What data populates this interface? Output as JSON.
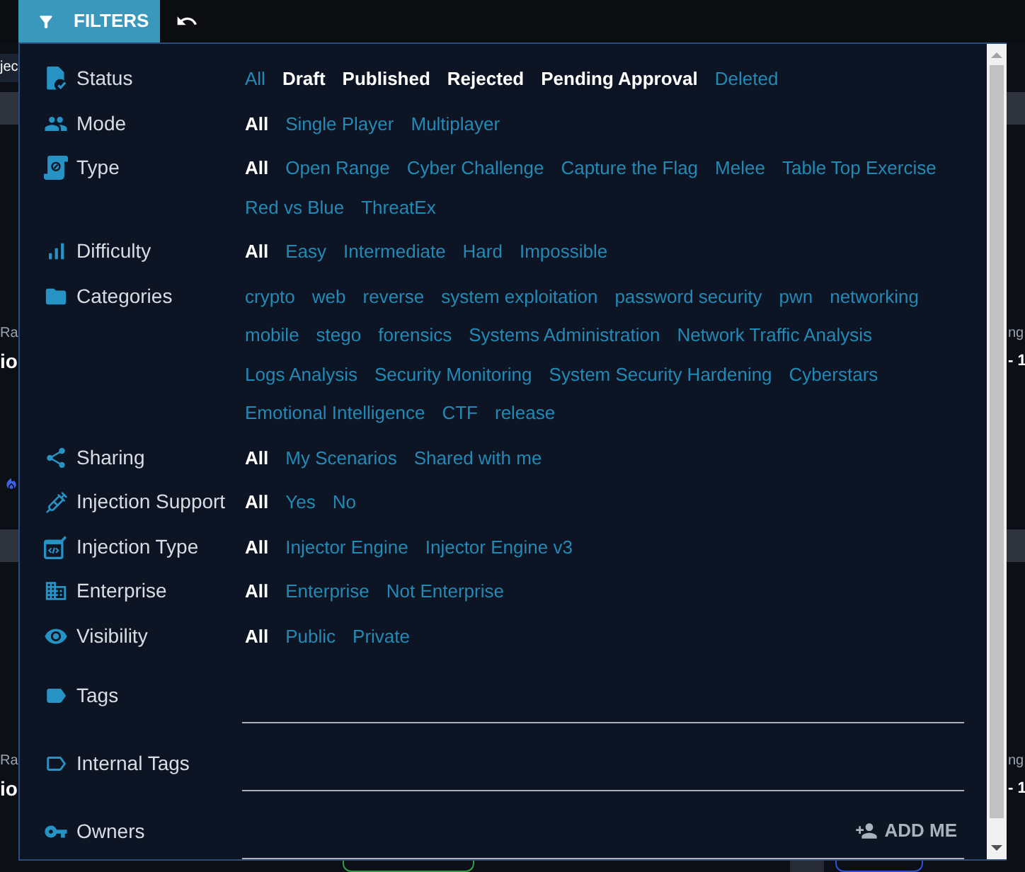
{
  "toolbar": {
    "filter_button": "FILTERS"
  },
  "background": {
    "tab": "jec",
    "left_cards": [
      {
        "subtitle": "Ra",
        "title": "io"
      },
      {
        "subtitle": "Ra",
        "title": "io"
      }
    ],
    "right_cards": [
      {
        "subtitle": "ng",
        "title": "- 1"
      },
      {
        "subtitle": "ng",
        "title": "- 1"
      }
    ]
  },
  "filters": [
    {
      "kind": "options",
      "label": "Status",
      "options": [
        {
          "label": "All",
          "selected": false
        },
        {
          "label": "Draft",
          "selected": true
        },
        {
          "label": "Published",
          "selected": true
        },
        {
          "label": "Rejected",
          "selected": true
        },
        {
          "label": "Pending Approval",
          "selected": true
        },
        {
          "label": "Deleted",
          "selected": false
        }
      ]
    },
    {
      "kind": "options",
      "label": "Mode",
      "options": [
        {
          "label": "All",
          "selected": true
        },
        {
          "label": "Single Player",
          "selected": false
        },
        {
          "label": "Multiplayer",
          "selected": false
        }
      ]
    },
    {
      "kind": "options",
      "label": "Type",
      "options": [
        {
          "label": "All",
          "selected": true
        },
        {
          "label": "Open Range",
          "selected": false
        },
        {
          "label": "Cyber Challenge",
          "selected": false
        },
        {
          "label": "Capture the Flag",
          "selected": false
        },
        {
          "label": "Melee",
          "selected": false
        },
        {
          "label": "Table Top Exercise",
          "selected": false
        },
        {
          "label": "Red vs Blue",
          "selected": false
        },
        {
          "label": "ThreatEx",
          "selected": false
        }
      ]
    },
    {
      "kind": "options",
      "label": "Difficulty",
      "options": [
        {
          "label": "All",
          "selected": true
        },
        {
          "label": "Easy",
          "selected": false
        },
        {
          "label": "Intermediate",
          "selected": false
        },
        {
          "label": "Hard",
          "selected": false
        },
        {
          "label": "Impossible",
          "selected": false
        }
      ]
    },
    {
      "kind": "options",
      "label": "Categories",
      "options": [
        {
          "label": "crypto",
          "selected": false
        },
        {
          "label": "web",
          "selected": false
        },
        {
          "label": "reverse",
          "selected": false
        },
        {
          "label": "system exploitation",
          "selected": false
        },
        {
          "label": "password security",
          "selected": false
        },
        {
          "label": "pwn",
          "selected": false
        },
        {
          "label": "networking",
          "selected": false
        },
        {
          "label": "mobile",
          "selected": false
        },
        {
          "label": "stego",
          "selected": false
        },
        {
          "label": "forensics",
          "selected": false
        },
        {
          "label": "Systems Administration",
          "selected": false
        },
        {
          "label": "Network Traffic Analysis",
          "selected": false
        },
        {
          "label": "Logs Analysis",
          "selected": false
        },
        {
          "label": "Security Monitoring",
          "selected": false
        },
        {
          "label": "System Security Hardening",
          "selected": false
        },
        {
          "label": "Cyberstars",
          "selected": false
        },
        {
          "label": "Emotional Intelligence",
          "selected": false
        },
        {
          "label": "CTF",
          "selected": false
        },
        {
          "label": "release",
          "selected": false
        }
      ]
    },
    {
      "kind": "options",
      "label": "Sharing",
      "options": [
        {
          "label": "All",
          "selected": true
        },
        {
          "label": "My Scenarios",
          "selected": false
        },
        {
          "label": "Shared with me",
          "selected": false
        }
      ]
    },
    {
      "kind": "options",
      "label": "Injection Support",
      "options": [
        {
          "label": "All",
          "selected": true
        },
        {
          "label": "Yes",
          "selected": false
        },
        {
          "label": "No",
          "selected": false
        }
      ]
    },
    {
      "kind": "options",
      "label": "Injection Type",
      "options": [
        {
          "label": "All",
          "selected": true
        },
        {
          "label": "Injector Engine",
          "selected": false
        },
        {
          "label": "Injector Engine v3",
          "selected": false
        }
      ]
    },
    {
      "kind": "options",
      "label": "Enterprise",
      "options": [
        {
          "label": "All",
          "selected": true
        },
        {
          "label": "Enterprise",
          "selected": false
        },
        {
          "label": "Not Enterprise",
          "selected": false
        }
      ]
    },
    {
      "kind": "options",
      "label": "Visibility",
      "options": [
        {
          "label": "All",
          "selected": true
        },
        {
          "label": "Public",
          "selected": false
        },
        {
          "label": "Private",
          "selected": false
        }
      ]
    },
    {
      "kind": "field",
      "label": "Tags"
    },
    {
      "kind": "field",
      "label": "Internal Tags"
    },
    {
      "kind": "field",
      "label": "Owners",
      "button": "ADD ME"
    }
  ]
}
